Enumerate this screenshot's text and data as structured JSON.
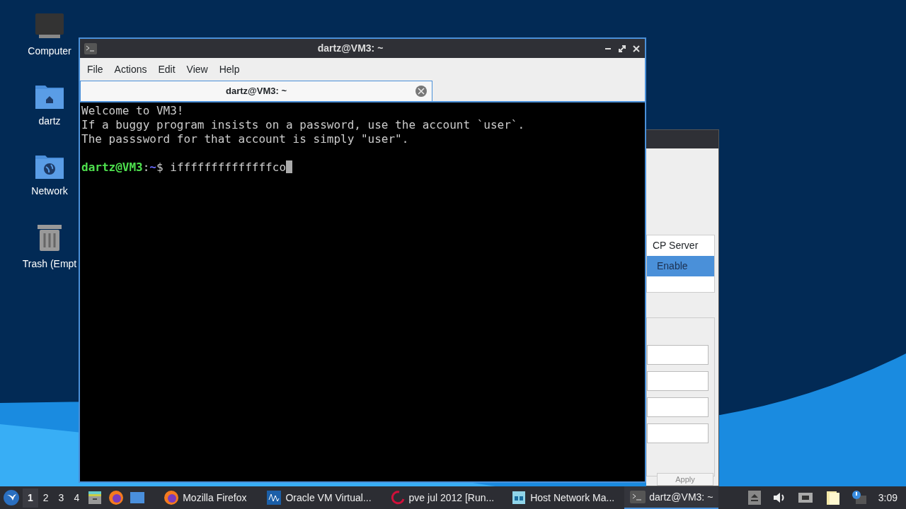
{
  "desktop_icons": [
    {
      "label": "Computer",
      "kind": "computer"
    },
    {
      "label": "dartz",
      "kind": "home"
    },
    {
      "label": "Network",
      "kind": "network"
    },
    {
      "label": "Trash (Empt",
      "kind": "trash"
    }
  ],
  "terminal": {
    "title": "dartz@VM3: ~",
    "menu": [
      "File",
      "Actions",
      "Edit",
      "View",
      "Help"
    ],
    "tab": {
      "label": "dartz@VM3: ~",
      "selected": true
    },
    "lines": [
      "Welcome to VM3!",
      "If a buggy program insists on a password, use the account `user`.",
      "The passsword for that account is simply \"user\"."
    ],
    "prompt": {
      "user_host": "dartz@VM3",
      "separator": ":",
      "path": "~",
      "symbol": "$",
      "command": "iffffffffffffffco"
    }
  },
  "background_window": {
    "list_header": "CP Server",
    "rows": [
      {
        "label": "Enable",
        "selected": true
      }
    ],
    "buttons": [
      "Apply"
    ]
  },
  "taskbar": {
    "workspaces": [
      {
        "label": "1",
        "selected": true
      },
      {
        "label": "2",
        "selected": false
      },
      {
        "label": "3",
        "selected": false
      },
      {
        "label": "4",
        "selected": false
      }
    ],
    "tasks": [
      {
        "label": "Mozilla Firefox",
        "kind": "firefox",
        "selected": false
      },
      {
        "label": "Oracle VM Virtual...",
        "kind": "vbox",
        "selected": false
      },
      {
        "label": "pve jul 2012 [Run...",
        "kind": "debian",
        "selected": false
      },
      {
        "label": "Host Network Ma...",
        "kind": "network",
        "selected": false
      },
      {
        "label": "dartz@VM3: ~",
        "kind": "terminal",
        "selected": true
      }
    ],
    "clock": "3:09"
  }
}
